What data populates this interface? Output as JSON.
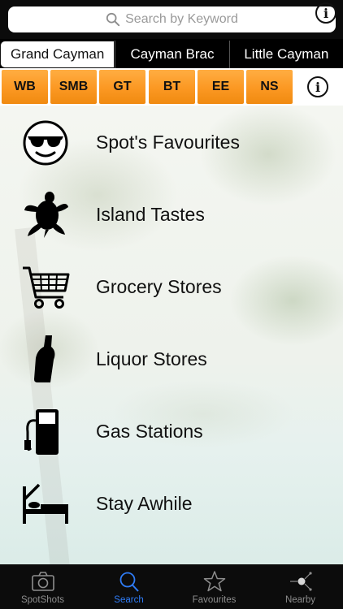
{
  "search": {
    "placeholder": "Search by Keyword",
    "info_glyph": "i"
  },
  "islands": [
    {
      "label": "Grand Cayman",
      "active": true
    },
    {
      "label": "Cayman Brac",
      "active": false
    },
    {
      "label": "Little Cayman",
      "active": false
    }
  ],
  "regions": {
    "buttons": [
      "WB",
      "SMB",
      "GT",
      "BT",
      "EE",
      "NS"
    ],
    "info_glyph": "i",
    "button_color": "#fb9822"
  },
  "categories": [
    {
      "label": "Spot's Favourites",
      "icon": "smiley-sunglasses-icon"
    },
    {
      "label": "Island Tastes",
      "icon": "turtle-icon"
    },
    {
      "label": "Grocery Stores",
      "icon": "shopping-cart-icon"
    },
    {
      "label": "Liquor Stores",
      "icon": "bottle-icon"
    },
    {
      "label": "Gas Stations",
      "icon": "gas-pump-icon"
    },
    {
      "label": "Stay Awhile",
      "icon": "bed-icon"
    }
  ],
  "tabbar": {
    "items": [
      {
        "label": "SpotShots",
        "icon": "camera-icon",
        "active": false
      },
      {
        "label": "Search",
        "icon": "search-icon",
        "active": true
      },
      {
        "label": "Favourites",
        "icon": "star-icon",
        "active": false
      },
      {
        "label": "Nearby",
        "icon": "nearby-icon",
        "active": false
      }
    ],
    "active_color": "#2f7cf6",
    "inactive_color": "#8e8e8e"
  }
}
